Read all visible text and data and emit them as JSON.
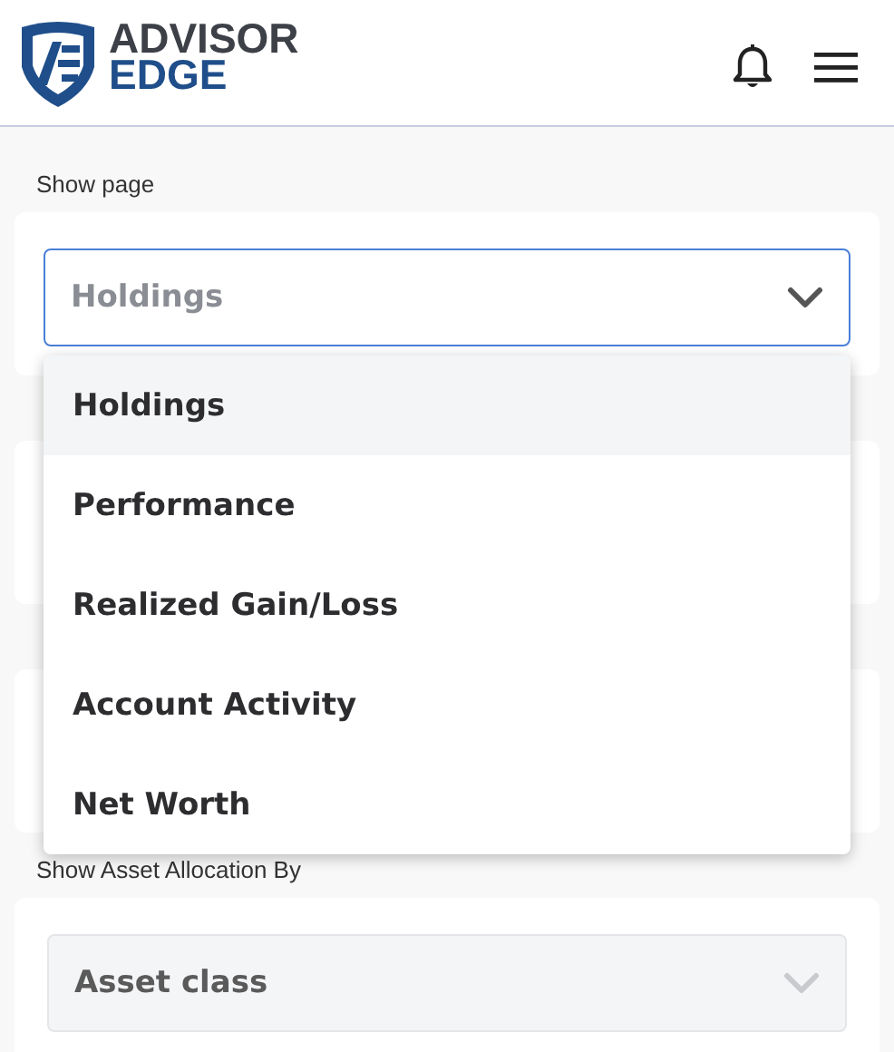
{
  "header": {
    "logo": {
      "line_1": "ADVISOR",
      "line_2": "EDGE"
    }
  },
  "show_page": {
    "label": "Show page",
    "value": "Holdings",
    "expanded": true,
    "options": [
      {
        "label": "Holdings",
        "selected": true
      },
      {
        "label": "Performance",
        "selected": false
      },
      {
        "label": "Realized Gain/Loss",
        "selected": false
      },
      {
        "label": "Account Activity",
        "selected": false
      },
      {
        "label": "Net Worth",
        "selected": false
      }
    ]
  },
  "asset_allocation": {
    "label": "Show Asset Allocation By",
    "value": "Asset class",
    "disabled": true
  }
}
